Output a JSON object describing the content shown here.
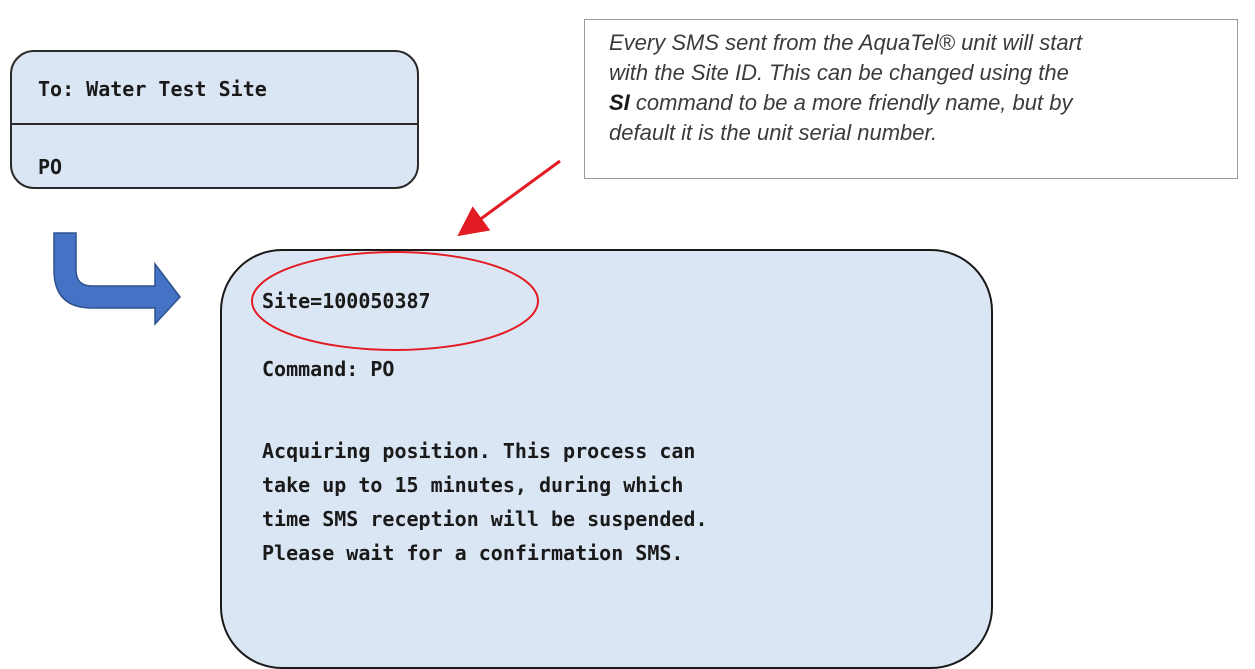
{
  "sent_message": {
    "recipient": "To: Water Test Site",
    "body": "PO"
  },
  "callout": {
    "line1": "Every SMS sent from the AquaTel® unit will start",
    "line2": "with the Site ID. This can be changed using the",
    "line3_command": "SI",
    "line3_rest": " command to be a more friendly name, but by",
    "line4": "default it is the unit serial number."
  },
  "reply_message": {
    "site_line": "Site=100050387",
    "command_line": "Command: PO",
    "body_lines": [
      "Acquiring position. This process can",
      "take up to 15 minutes, during which",
      "time SMS reception will be suspended.",
      "Please wait for a confirmation SMS."
    ]
  },
  "colors": {
    "bubble_fill": "#dbe6f4",
    "arrow_fill": "#4472c4",
    "highlight": "#e31b23"
  }
}
